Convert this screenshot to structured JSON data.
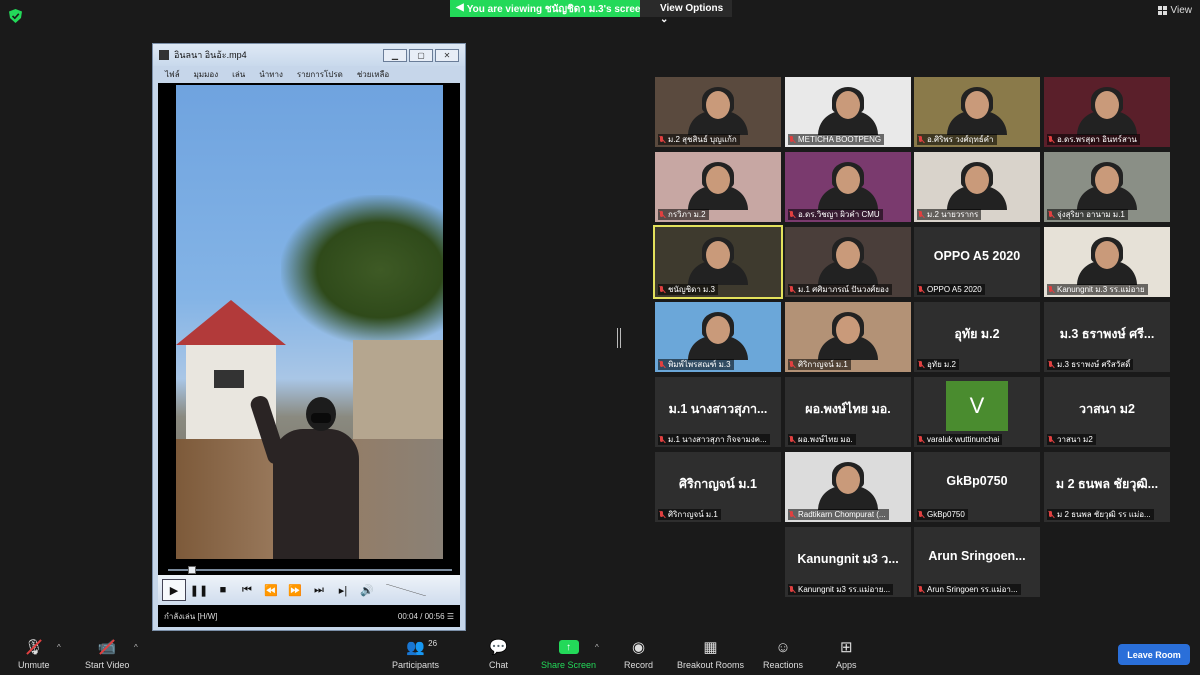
{
  "top": {
    "share_banner": "You are viewing ชนัญชิดา ม.3's screen",
    "view_options": "View Options",
    "view_button": "View"
  },
  "player": {
    "title": "อินลนา อินอ้ะ.mp4",
    "menu": [
      "ไฟล์",
      "มุมมอง",
      "เล่น",
      "นำทาง",
      "รายการโปรด",
      "ช่วยเหลือ"
    ],
    "status_left": "กำลังเล่น [H/W]",
    "time": "00:04 / 00:56",
    "progress_fraction": 0.07
  },
  "participants": [
    {
      "label": "ม.2 สุชสินธ์ บุญแก้ก",
      "type": "video",
      "bg": "#5a4a3e"
    },
    {
      "label": "METICHA BOOTPENG",
      "type": "video",
      "bg": "#e9e9e9"
    },
    {
      "label": "อ.ศิริพร วงศ์ฤทธ์คำ",
      "type": "video",
      "bg": "#8a7a4a"
    },
    {
      "label": "อ.ดร.พรสุดา อินทร์สาน",
      "type": "video",
      "bg": "#5a1f2a"
    },
    {
      "label": "กรวิภา ม.2",
      "type": "video",
      "bg": "#c7a7a3"
    },
    {
      "label": "อ.ดร.วิชญา ผิวคำ CMU",
      "type": "video",
      "bg": "#7a3a6e"
    },
    {
      "label": "ม.2 นายวรากร",
      "type": "video",
      "bg": "#d9d3cb"
    },
    {
      "label": "จุ่งสุริยา อานาม ม.1",
      "type": "video",
      "bg": "#8a8f86"
    },
    {
      "label": "ชนัญชิดา ม.3",
      "type": "video",
      "bg": "#3e3a2e",
      "active": true
    },
    {
      "label": "ม.1 ศศิมาภรณ์ ปันวงศ์ยอง",
      "type": "video",
      "bg": "#4a3e3a"
    },
    {
      "label": "OPPO A5 2020",
      "type": "name",
      "center": "OPPO A5 2020"
    },
    {
      "label": "Kanungnit ม.3 รร.แม่อาย",
      "type": "video",
      "bg": "#e6e1d7"
    },
    {
      "label": "พิมพ์ไพรสณฑ์ ม.3",
      "type": "photo",
      "bg": "#6ba7d9"
    },
    {
      "label": "ศิริกาญจน์ ม.1",
      "type": "photo",
      "bg": "#b39276"
    },
    {
      "label": "อุทัย ม.2",
      "type": "name",
      "center": "อุทัย ม.2"
    },
    {
      "label": "ม.3 ธราพงษ์ ศรีสวัสดิ์",
      "type": "name",
      "center": "ม.3 ธราพงษ์ ศรี..."
    },
    {
      "label": "ม.1 นางสาวสุภา กิจจามงค...",
      "type": "name",
      "center": "ม.1 นางสาวสุภา..."
    },
    {
      "label": "ผอ.พงษ์ไทย มอ.",
      "type": "name",
      "center": "ผอ.พงษ์ไทย มอ."
    },
    {
      "label": "varaluk wuttinunchai",
      "type": "letter",
      "center": "V"
    },
    {
      "label": "วาสนา ม2",
      "type": "name",
      "center": "วาสนา ม2"
    },
    {
      "label": "ศิริกาญจน์ ม.1",
      "type": "name",
      "center": "ศิริกาญจน์ ม.1"
    },
    {
      "label": "Radtikarn Chompurat (...",
      "type": "photo",
      "bg": "#dcdcdc"
    },
    {
      "label": "GkBp0750",
      "type": "name",
      "center": "GkBp0750"
    },
    {
      "label": "ม 2 ธนพล ชัยวุฒิ รร แม่อ...",
      "type": "name",
      "center": "ม 2 ธนพล ชัยวุฒิ..."
    },
    {
      "label": "Kanungnit ม3 รร.แม่อาย...",
      "type": "name",
      "center": "Kanungnit ม3 ว..."
    },
    {
      "label": "Arun Sringoen รร.แม่อา...",
      "type": "name",
      "center": "Arun  Sringoen..."
    }
  ],
  "toolbar": {
    "unmute": "Unmute",
    "start_video": "Start Video",
    "participants": "Participants",
    "participants_count": "26",
    "chat": "Chat",
    "share_screen": "Share Screen",
    "record": "Record",
    "breakout_rooms": "Breakout Rooms",
    "reactions": "Reactions",
    "apps": "Apps",
    "leave_room": "Leave Room"
  },
  "colors": {
    "share_green": "#23d959",
    "leave_blue": "#2a6fd9",
    "active_speaker": "#e3e15c",
    "mute_red": "#e04040"
  }
}
